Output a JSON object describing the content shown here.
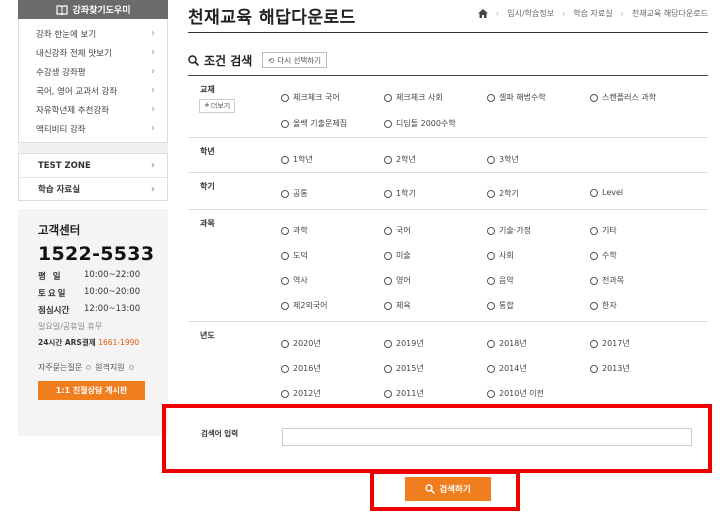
{
  "sidebar": {
    "header": "강좌찾기도우미",
    "menu": [
      "강좌 한눈에 보기",
      "내신강좌 전체 맛보기",
      "수강생 강좌평",
      "국어, 영어 교과서 강좌",
      "자유학년제 추천강좌",
      "액티비티 강좌"
    ],
    "zone": [
      "TEST ZONE",
      "학습 자료실"
    ]
  },
  "customer_service": {
    "title": "고객센터",
    "phone": "1522-5533",
    "hours": [
      {
        "day": "평 일",
        "time": "10:00~22:00"
      },
      {
        "day": "토요일",
        "time": "10:00~20:00"
      },
      {
        "day": "점심시간",
        "time": "12:00~13:00"
      }
    ],
    "note": "일요일/공휴일 휴무",
    "ars_label": "24시간 ARS결제",
    "ars_number": "1661-1990",
    "links": [
      "자주묻는질문",
      "원격지원"
    ],
    "consult_button": "1:1 친절상담 게시판"
  },
  "header": {
    "title": "천재교육 해답다운로드",
    "breadcrumb": [
      "입시/학습정보",
      "학습 자료실",
      "천재교육 해답다운로드"
    ]
  },
  "search": {
    "title": "조건 검색",
    "reset_label": "다시 선택하기",
    "more_label": "더보기",
    "filters": [
      {
        "label": "교재",
        "options": [
          "체크체크 국어",
          "체크체크 사회",
          "셀파 해법수학",
          "스캔플러스 과학",
          "올백 기출문제집",
          "디딤돌 2000수학"
        ]
      },
      {
        "label": "학년",
        "options": [
          "1학년",
          "2학년",
          "3학년"
        ]
      },
      {
        "label": "학기",
        "options": [
          "공통",
          "1학기",
          "2학기",
          "Level"
        ]
      },
      {
        "label": "과목",
        "options": [
          "과학",
          "국어",
          "기술·가정",
          "기타",
          "도덕",
          "미술",
          "사회",
          "수학",
          "역사",
          "영어",
          "음악",
          "전과목",
          "제2외국어",
          "체육",
          "통합",
          "한자"
        ]
      },
      {
        "label": "년도",
        "options": [
          "2020년",
          "2019년",
          "2018년",
          "2017년",
          "2016년",
          "2015년",
          "2014년",
          "2013년",
          "2012년",
          "2011년",
          "2010년 이전"
        ]
      }
    ],
    "keyword_label": "검색어 입력",
    "keyword_value": "",
    "search_button": "검색하기"
  },
  "colors": {
    "accent": "#f07d1e",
    "highlight": "#ee0000",
    "sidebar_header": "#6b6b6b"
  }
}
